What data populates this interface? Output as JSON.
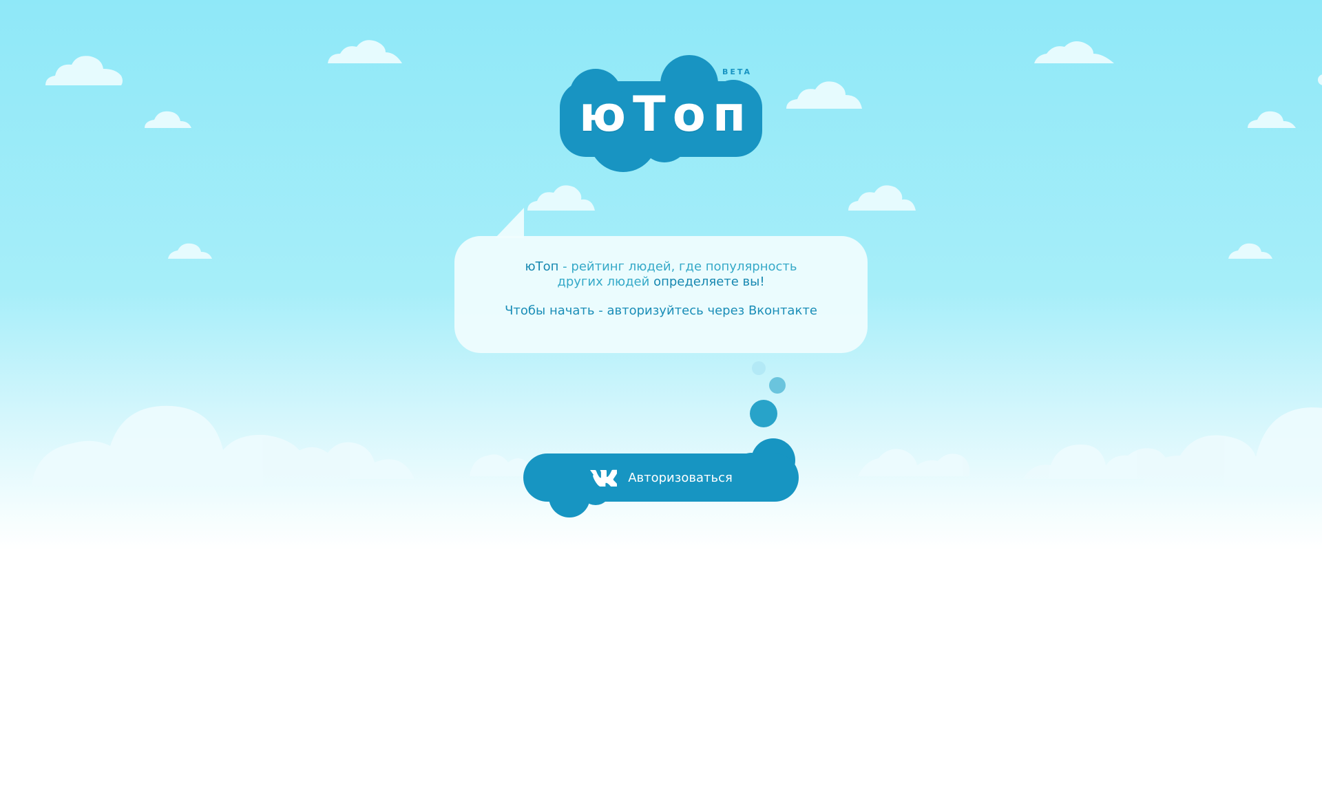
{
  "logo": {
    "wordmark": "юТоп",
    "badge": "BETA"
  },
  "intro": {
    "brand": "юТоп",
    "tagline": " - рейтинг людей, где популярность других людей ",
    "emphasis": "определяете вы!",
    "cta_prefix": "Чтобы начать - ",
    "cta_link": "авторизуйтесь",
    "cta_suffix": " через Вконтакте"
  },
  "auth": {
    "button_label": "Авторизоваться",
    "icon": "vk-icon"
  },
  "colors": {
    "sky_top": "#8fe8f8",
    "accent": "#1795c2",
    "text": "#1a93b9",
    "bubble": "#f0fdfe"
  }
}
